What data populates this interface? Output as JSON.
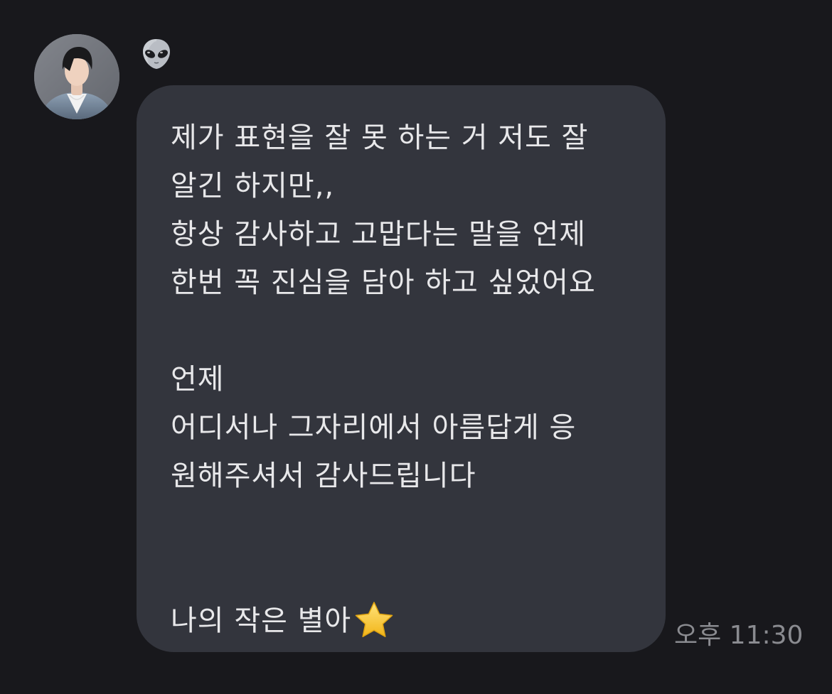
{
  "chat": {
    "sender": {
      "name_emoji": "👽",
      "avatar_icon": "profile-photo"
    },
    "message": {
      "lines": [
        "제가 표현을 잘 못 하는 거 저도 잘",
        "알긴 하지만,,",
        "항상 감사하고 고맙다는 말을 언제",
        "한번 꼭 진심을 담아 하고 싶었어요",
        "",
        "언제",
        "어디서나 그자리에서 아름답게 응",
        "원해주셔서 감사드립니다",
        "",
        "",
        "나의 작은 별아"
      ],
      "trailing_emoji_icon": "star-icon",
      "timestamp": "오후 11:30"
    }
  },
  "colors": {
    "background": "#18181c",
    "bubble": "#33353d",
    "text": "#e8e8ea",
    "timestamp": "#8a8b90",
    "star": "#f7c531"
  }
}
